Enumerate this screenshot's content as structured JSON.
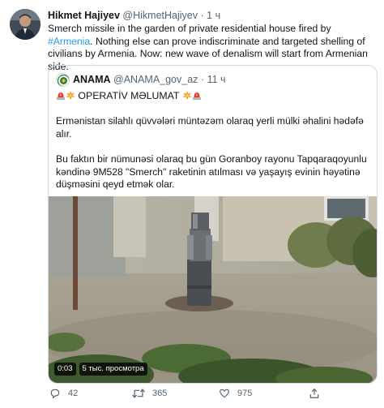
{
  "tweet": {
    "author_name": "Hikmet Hajiyev",
    "author_handle": "@HikmetHajiyev",
    "separator": "·",
    "time": "1 ч",
    "text_part1": "Smerch missile in the garden of private residential house fired by ",
    "hashtag": "#Armenia",
    "text_part2": ". Nothing else can prove indiscriminate and targeted shelling of civilians by Armenia. Now: new wave of denalism will start from Armenian side."
  },
  "quote": {
    "author_name": "ANAMA",
    "author_handle": "@ANAMA_gov_az",
    "separator": "·",
    "time": "11 ч",
    "headline": "OPERATİV MƏLUMAT",
    "paragraph1": "Ermənistan silahlı qüvvələri müntəzəm olaraq yerli mülki əhalini hədəfə alır.",
    "paragraph2": "Bu faktın bir nümunəsi olaraq bu  gün Goranboy rayonu Tapqaraqoyunlu kəndinə 9M528 \"Smerch\" raketinin atılması və yaşayış evinin həyətinə düşməsini qeyd etmək olar.",
    "video": {
      "duration": "0:03",
      "views": "5 тыс. просмотра"
    }
  },
  "actions": {
    "replies": "42",
    "retweets": "365",
    "likes": "975"
  },
  "icons": {
    "reply": "reply-icon",
    "retweet": "retweet-icon",
    "like": "heart-icon",
    "share": "share-icon",
    "emoji_siren": "police-light-icon",
    "emoji_collision": "collision-icon"
  },
  "colors": {
    "link": "#1d9bf0",
    "secondary_text": "#536471",
    "border": "#cfd9de"
  }
}
